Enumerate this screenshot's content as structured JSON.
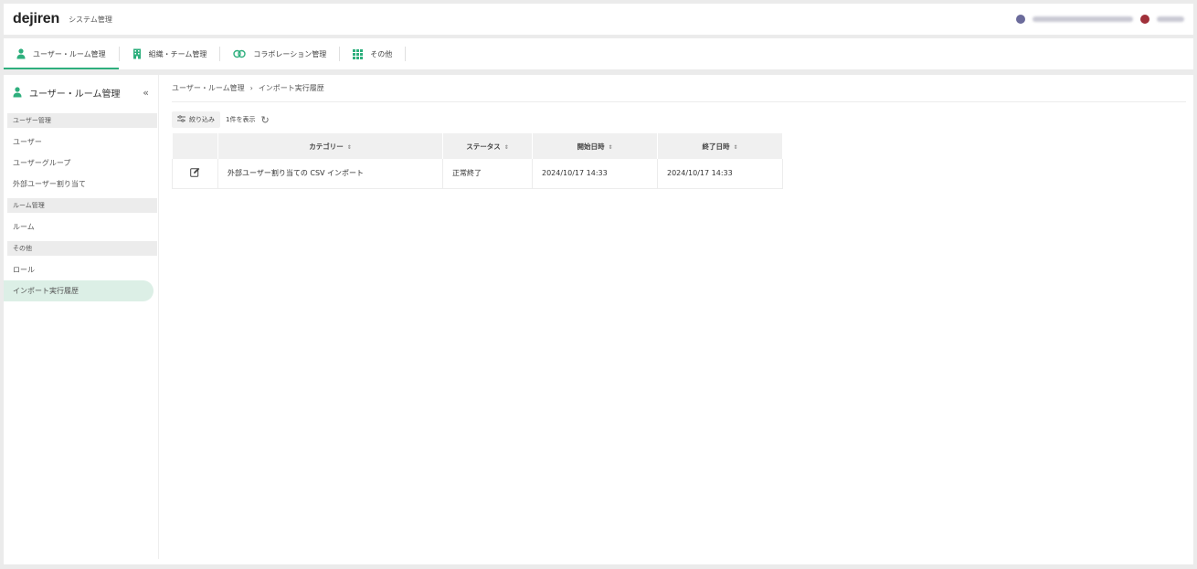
{
  "header": {
    "logo": "dejiren",
    "app_title": "システム管理"
  },
  "tabs": [
    {
      "label": "ユーザー・ルーム管理",
      "icon": "person-icon",
      "active": true
    },
    {
      "label": "組織・チーム管理",
      "icon": "building-icon",
      "active": false
    },
    {
      "label": "コラボレーション管理",
      "icon": "link-icon",
      "active": false
    },
    {
      "label": "その他",
      "icon": "grid-icon",
      "active": false
    }
  ],
  "sidebar": {
    "title": "ユーザー・ルーム管理",
    "collapse_icon": "double-chevron-left-icon",
    "groups": [
      {
        "label": "ユーザー管理",
        "items": [
          {
            "label": "ユーザー"
          },
          {
            "label": "ユーザーグループ"
          },
          {
            "label": "外部ユーザー割り当て"
          }
        ]
      },
      {
        "label": "ルーム管理",
        "items": [
          {
            "label": "ルーム"
          }
        ]
      },
      {
        "label": "その他",
        "items": [
          {
            "label": "ロール"
          },
          {
            "label": "インポート実行履歴",
            "active": true
          }
        ]
      }
    ]
  },
  "breadcrumb": {
    "parent": "ユーザー・ルーム管理",
    "separator": "›",
    "current": "インポート実行履歴"
  },
  "toolbar": {
    "filter_label": "絞り込み",
    "count_text": "1件を表示"
  },
  "table": {
    "columns": [
      "",
      "カテゴリー",
      "ステータス",
      "開始日時",
      "終了日時"
    ],
    "sort_glyph": "⇕",
    "rows": [
      {
        "category": "外部ユーザー割り当ての CSV インポート",
        "status": "正常終了",
        "start": "2024/10/17 14:33",
        "end": "2024/10/17 14:33"
      }
    ]
  },
  "colors": {
    "accent": "#2eaf7d",
    "active_bg": "#dcefe6",
    "background": "#ebebeb"
  }
}
